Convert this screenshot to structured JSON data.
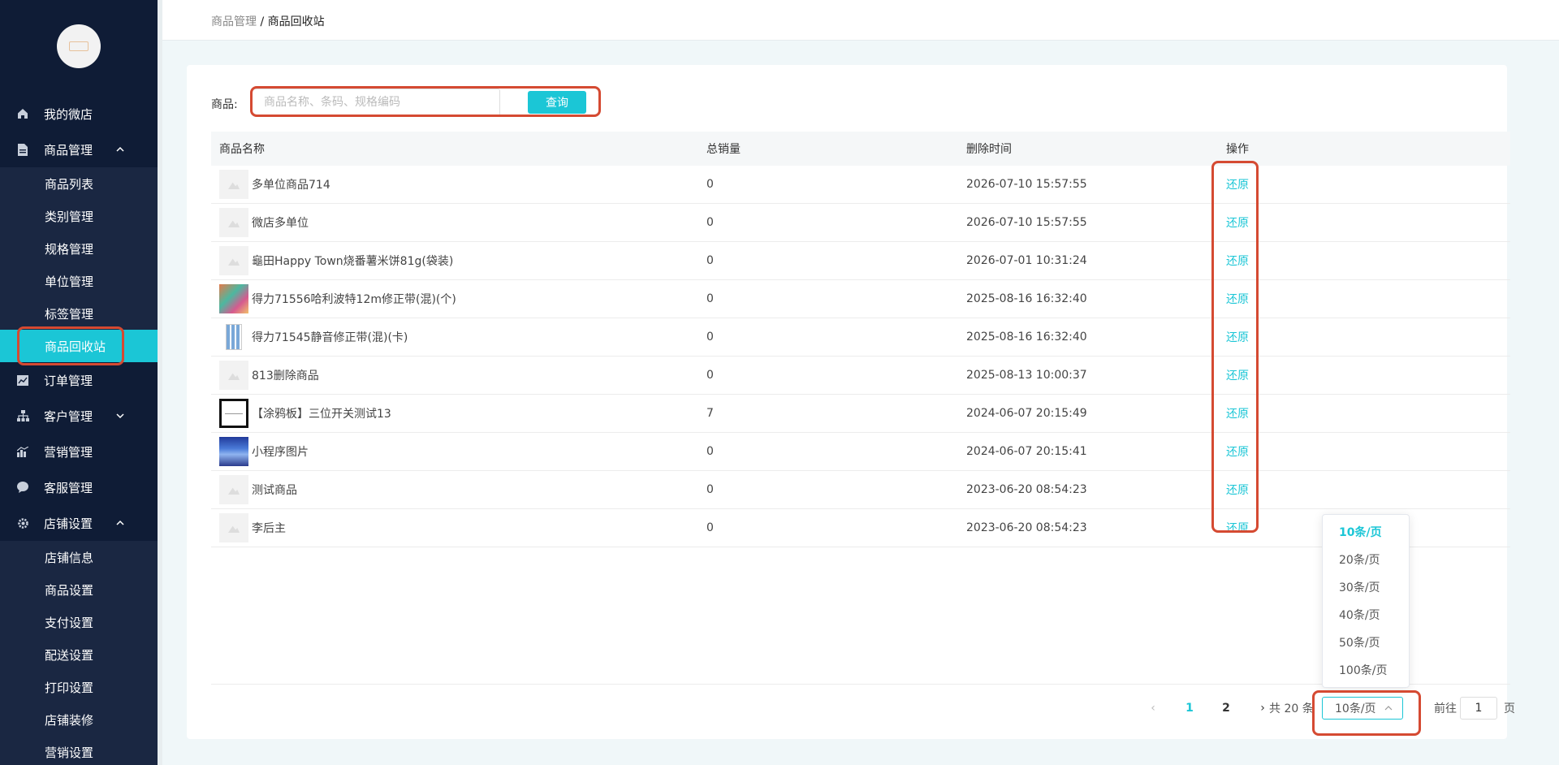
{
  "sidebar": {
    "items": [
      {
        "label": "我的微店"
      },
      {
        "label": "商品管理"
      },
      {
        "label": "订单管理"
      },
      {
        "label": "客户管理"
      },
      {
        "label": "营销管理"
      },
      {
        "label": "客服管理"
      },
      {
        "label": "店铺设置"
      }
    ],
    "goods_sub": [
      "商品列表",
      "类别管理",
      "规格管理",
      "单位管理",
      "标签管理",
      "商品回收站"
    ],
    "shop_sub": [
      "店铺信息",
      "商品设置",
      "支付设置",
      "配送设置",
      "打印设置",
      "店铺装修",
      "营销设置"
    ]
  },
  "breadcrumb": {
    "parent": "商品管理",
    "sep": " / ",
    "current": "商品回收站"
  },
  "search": {
    "label": "商品:",
    "placeholder": "商品名称、条码、规格编码",
    "button": "查询"
  },
  "table": {
    "headers": {
      "name": "商品名称",
      "sales": "总销量",
      "time": "删除时间",
      "op": "操作"
    },
    "action_label": "还原",
    "rows": [
      {
        "name": "多单位商品714",
        "sales": "0",
        "time": "2026-07-10 15:57:55",
        "thumb": "placeholder"
      },
      {
        "name": "微店多单位",
        "sales": "0",
        "time": "2026-07-10 15:57:55",
        "thumb": "placeholder"
      },
      {
        "name": "龜田Happy Town烧番薯米饼81g(袋装)",
        "sales": "0",
        "time": "2026-07-01 10:31:24",
        "thumb": "placeholder"
      },
      {
        "name": "得力71556哈利波特12m修正带(混)(个)",
        "sales": "0",
        "time": "2025-08-16 16:32:40",
        "thumb": "img1"
      },
      {
        "name": "得力71545静音修正带(混)(卡)",
        "sales": "0",
        "time": "2025-08-16 16:32:40",
        "thumb": "img2"
      },
      {
        "name": "813删除商品",
        "sales": "0",
        "time": "2025-08-13 10:00:37",
        "thumb": "placeholder"
      },
      {
        "name": "【涂鸦板】三位开关测试13",
        "sales": "7",
        "time": "2024-06-07 20:15:49",
        "thumb": "img3"
      },
      {
        "name": "小程序图片",
        "sales": "0",
        "time": "2024-06-07 20:15:41",
        "thumb": "img4"
      },
      {
        "name": "测试商品",
        "sales": "0",
        "time": "2023-06-20 08:54:23",
        "thumb": "placeholder"
      },
      {
        "name": "李后主",
        "sales": "0",
        "time": "2023-06-20 08:54:23",
        "thumb": "placeholder"
      }
    ]
  },
  "pagination": {
    "prev": "‹",
    "page1": "1",
    "page2": "2",
    "next": "›",
    "total": "共 20 条",
    "page_size": "10条/页",
    "goto_label": "前往",
    "goto_value": "1",
    "page_label": "页"
  },
  "page_size_options": [
    "10条/页",
    "20条/页",
    "30条/页",
    "40条/页",
    "50条/页",
    "100条/页"
  ],
  "colors": {
    "accent": "#1bc6d6",
    "sidebar_bg": "#0f1c36",
    "highlight": "#d54a32"
  }
}
